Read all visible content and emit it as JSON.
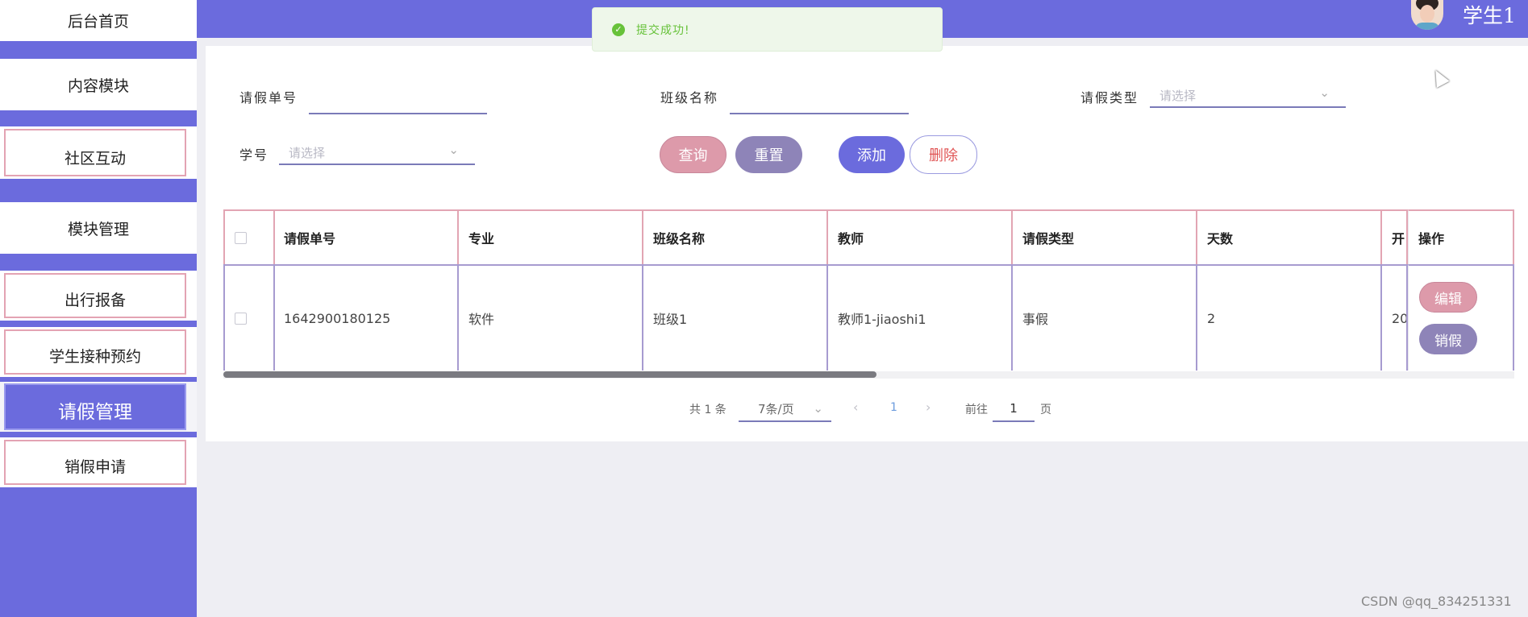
{
  "sidebar": {
    "items": [
      {
        "label": "后台首页"
      },
      {
        "label": "内容模块"
      },
      {
        "label": "社区互动"
      },
      {
        "label": "模块管理"
      },
      {
        "label": "出行报备"
      },
      {
        "label": "学生接种预约"
      },
      {
        "label": "请假管理"
      },
      {
        "label": "销假申请"
      }
    ]
  },
  "header": {
    "username": "学生1",
    "avatar": "user-avatar"
  },
  "toast": {
    "message": "提交成功!",
    "icon": "check-circle-icon",
    "color": "#67c23a"
  },
  "filters": {
    "leave_no_label": "请假单号",
    "leave_no_value": "",
    "class_name_label": "班级名称",
    "class_name_value": "",
    "leave_type_label": "请假类型",
    "leave_type_placeholder": "请选择",
    "student_no_label": "学号",
    "student_no_placeholder": "请选择"
  },
  "buttons": {
    "query": "查询",
    "reset": "重置",
    "add": "添加",
    "delete": "删除"
  },
  "table": {
    "headers": [
      "请假单号",
      "专业",
      "班级名称",
      "教师",
      "请假类型",
      "天数",
      "开",
      "操作"
    ],
    "rows": [
      {
        "leave_no": "1642900180125",
        "major": "软件",
        "class_name": "班级1",
        "teacher": "教师1-jiaoshi1",
        "leave_type": "事假",
        "days": "2",
        "start": "20",
        "edit": "编辑",
        "cancel_leave": "销假"
      }
    ]
  },
  "pagination": {
    "total": "共 1 条",
    "page_size": "7条/页",
    "current_page": "1",
    "goto_label": "前往",
    "goto_value": "1",
    "page_unit": "页"
  },
  "watermark": "CSDN @qq_834251331",
  "colors": {
    "primary": "#6b6bdd",
    "pink": "#dd9aaa",
    "mauve": "#8e84b8",
    "success": "#67c23a"
  }
}
